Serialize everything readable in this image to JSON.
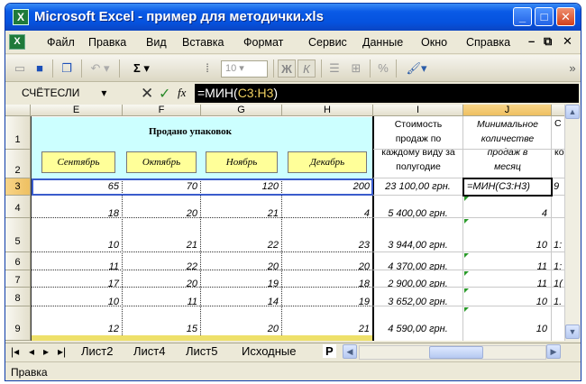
{
  "window": {
    "title": "Microsoft Excel - пример для методички.xls",
    "app_icon": "excel-icon"
  },
  "menu": {
    "items": [
      "Файл",
      "Правка",
      "Вид",
      "Вставка",
      "Формат",
      "Сервис",
      "Данные",
      "Окно",
      "Справка"
    ]
  },
  "toolbar": {
    "sum": "Σ ▾",
    "font_size": "10",
    "bold": "Ж",
    "italic": "К",
    "percent": "%",
    "paint": "🖌▾"
  },
  "formula_bar": {
    "name_box": "СЧЁТЕСЛИ",
    "cancel": "✕",
    "enter": "✓",
    "fx": "fx",
    "prefix": "=МИН(",
    "ref": "C3:H3",
    "suffix": ")"
  },
  "columns": [
    "E",
    "F",
    "G",
    "H",
    "I",
    "J"
  ],
  "active_column": "J",
  "rows": [
    "1",
    "2",
    "3",
    "4",
    "5",
    "6",
    "7",
    "8",
    "9"
  ],
  "active_row": "3",
  "sheet": {
    "header_title": "Продано упаковок",
    "months": [
      "Сентябрь",
      "Октябрь",
      "Ноябрь",
      "Декабрь"
    ],
    "col_i_header": [
      "Стоимость",
      "продаж по",
      "каждому виду за",
      "полугодие"
    ],
    "col_j_header": [
      "Минимальное",
      "количестве",
      "продаж в",
      "месяц"
    ],
    "col_k_header_fragment": "С",
    "col_k_fragment2": "ко",
    "data": [
      {
        "row": "3",
        "e": "65",
        "f": "70",
        "g": "120",
        "h": "200",
        "i": "23 100,00 грн.",
        "j": "=МИН(C3:H3)",
        "k": "9"
      },
      {
        "row": "4",
        "e": "18",
        "f": "20",
        "g": "21",
        "h": "4",
        "i": "5 400,00 грн.",
        "j": "4",
        "k": ""
      },
      {
        "row": "5",
        "e": "10",
        "f": "21",
        "g": "22",
        "h": "23",
        "i": "3 944,00 грн.",
        "j": "10",
        "k": "1:"
      },
      {
        "row": "6",
        "e": "11",
        "f": "22",
        "g": "20",
        "h": "20",
        "i": "4 370,00 грн.",
        "j": "11",
        "k": "1:"
      },
      {
        "row": "7",
        "e": "17",
        "f": "20",
        "g": "19",
        "h": "18",
        "i": "2 900,00 грн.",
        "j": "11",
        "k": "1("
      },
      {
        "row": "8",
        "e": "10",
        "f": "11",
        "g": "14",
        "h": "19",
        "i": "3 652,00 грн.",
        "j": "10",
        "k": "1."
      },
      {
        "row": "9",
        "e": "12",
        "f": "15",
        "g": "20",
        "h": "21",
        "i": "4 590,00 грн.",
        "j": "10",
        "k": ""
      }
    ]
  },
  "tabs": [
    "Лист2",
    "Лист4",
    "Лист5",
    "Исходные",
    "Р"
  ],
  "active_tab": "Р",
  "status": "Правка"
}
